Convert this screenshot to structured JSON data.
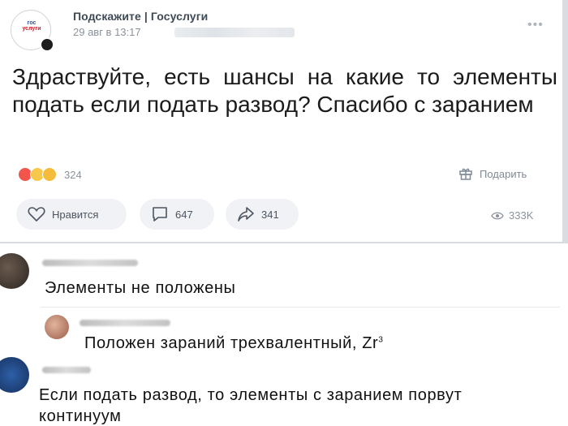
{
  "post": {
    "author": "Подскажите | Госуслуги",
    "date": "29 авг в 13:17",
    "avatar_icon": "gosuslugi-logo",
    "more_icon": "ellipsis-icon",
    "text": "Здраствуйте, есть шансы на какие то элементы подать если подать развод? Спасибо с заранием",
    "reactions_count": "324",
    "gift_label": "Подарить",
    "like_label": "Нравится",
    "comments_count": "647",
    "shares_count": "341",
    "views_count": "333K"
  },
  "comments": [
    {
      "text": "Элементы не положены"
    },
    {
      "text_main": "Положен зараний трехвалентный, Zr",
      "text_sup": "3"
    },
    {
      "text_line1": "Если подать развод, то элементы с заранием порвут",
      "text_line2": "континуум"
    }
  ],
  "colors": {
    "accent_text": "#3f4a57",
    "muted": "#8a929c",
    "pill_bg": "#f0f2f5"
  }
}
